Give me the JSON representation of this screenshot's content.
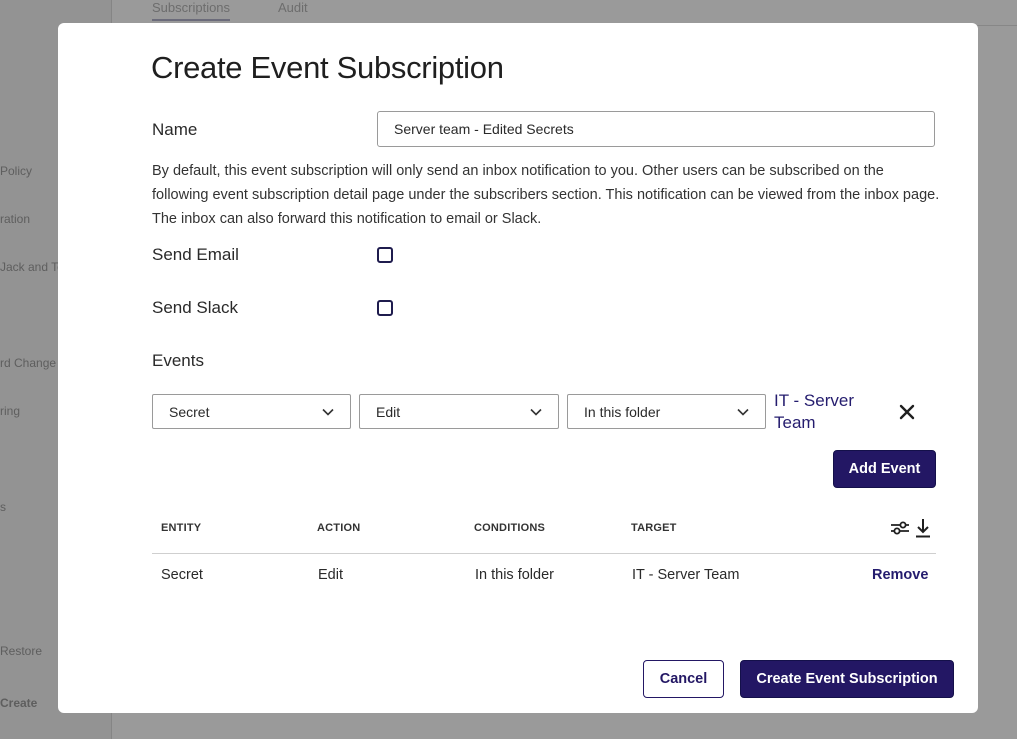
{
  "background": {
    "tabs": [
      {
        "label": "Subscriptions"
      },
      {
        "label": "Audit"
      }
    ],
    "sidebar_items": [
      {
        "label": "Policy"
      },
      {
        "label": "ration"
      },
      {
        "label": "Jack and Te"
      },
      {
        "label": "rd Change"
      },
      {
        "label": "ring"
      },
      {
        "label": "s"
      },
      {
        "label": "Restore"
      },
      {
        "label": "Create"
      }
    ]
  },
  "modal": {
    "title": "Create Event Subscription",
    "name_label": "Name",
    "name_value": "Server team - Edited Secrets",
    "description": "By default, this event subscription will only send an inbox notification to you. Other users can be subscribed on the following event subscription detail page under the subscribers section. This notification can be viewed from the inbox page. The inbox can also forward this notification to email or Slack.",
    "send_email_label": "Send Email",
    "send_email_checked": false,
    "send_slack_label": "Send Slack",
    "send_slack_checked": false,
    "events_label": "Events",
    "event_row": {
      "entity": "Secret",
      "action": "Edit",
      "condition": "In this folder",
      "target": "IT - Server Team"
    },
    "add_event_label": "Add Event",
    "table": {
      "headers": [
        "ENTITY",
        "ACTION",
        "CONDITIONS",
        "TARGET"
      ],
      "rows": [
        {
          "entity": "Secret",
          "action": "Edit",
          "conditions": "In this folder",
          "target": "IT - Server Team",
          "remove_label": "Remove"
        }
      ]
    },
    "cancel_label": "Cancel",
    "submit_label": "Create Event Subscription"
  },
  "colors": {
    "primary": "#231764",
    "link": "#241c6e",
    "overlay": "#9a9a9a"
  },
  "icons": [
    "chevron-down-icon",
    "close-icon",
    "filter-sliders-icon",
    "download-icon"
  ]
}
